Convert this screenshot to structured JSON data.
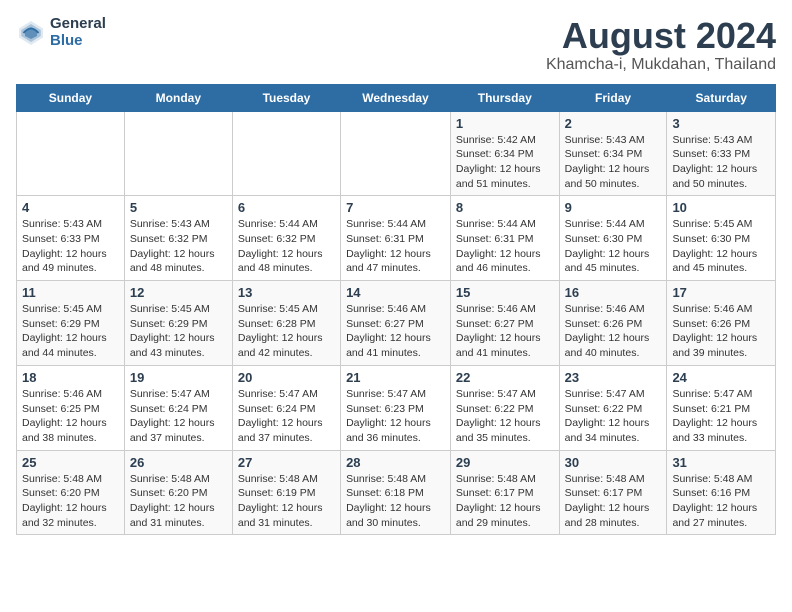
{
  "header": {
    "logo_general": "General",
    "logo_blue": "Blue",
    "title": "August 2024",
    "subtitle": "Khamcha-i, Mukdahan, Thailand"
  },
  "weekdays": [
    "Sunday",
    "Monday",
    "Tuesday",
    "Wednesday",
    "Thursday",
    "Friday",
    "Saturday"
  ],
  "weeks": [
    [
      {
        "day": "",
        "detail": ""
      },
      {
        "day": "",
        "detail": ""
      },
      {
        "day": "",
        "detail": ""
      },
      {
        "day": "",
        "detail": ""
      },
      {
        "day": "1",
        "detail": "Sunrise: 5:42 AM\nSunset: 6:34 PM\nDaylight: 12 hours\nand 51 minutes."
      },
      {
        "day": "2",
        "detail": "Sunrise: 5:43 AM\nSunset: 6:34 PM\nDaylight: 12 hours\nand 50 minutes."
      },
      {
        "day": "3",
        "detail": "Sunrise: 5:43 AM\nSunset: 6:33 PM\nDaylight: 12 hours\nand 50 minutes."
      }
    ],
    [
      {
        "day": "4",
        "detail": "Sunrise: 5:43 AM\nSunset: 6:33 PM\nDaylight: 12 hours\nand 49 minutes."
      },
      {
        "day": "5",
        "detail": "Sunrise: 5:43 AM\nSunset: 6:32 PM\nDaylight: 12 hours\nand 48 minutes."
      },
      {
        "day": "6",
        "detail": "Sunrise: 5:44 AM\nSunset: 6:32 PM\nDaylight: 12 hours\nand 48 minutes."
      },
      {
        "day": "7",
        "detail": "Sunrise: 5:44 AM\nSunset: 6:31 PM\nDaylight: 12 hours\nand 47 minutes."
      },
      {
        "day": "8",
        "detail": "Sunrise: 5:44 AM\nSunset: 6:31 PM\nDaylight: 12 hours\nand 46 minutes."
      },
      {
        "day": "9",
        "detail": "Sunrise: 5:44 AM\nSunset: 6:30 PM\nDaylight: 12 hours\nand 45 minutes."
      },
      {
        "day": "10",
        "detail": "Sunrise: 5:45 AM\nSunset: 6:30 PM\nDaylight: 12 hours\nand 45 minutes."
      }
    ],
    [
      {
        "day": "11",
        "detail": "Sunrise: 5:45 AM\nSunset: 6:29 PM\nDaylight: 12 hours\nand 44 minutes."
      },
      {
        "day": "12",
        "detail": "Sunrise: 5:45 AM\nSunset: 6:29 PM\nDaylight: 12 hours\nand 43 minutes."
      },
      {
        "day": "13",
        "detail": "Sunrise: 5:45 AM\nSunset: 6:28 PM\nDaylight: 12 hours\nand 42 minutes."
      },
      {
        "day": "14",
        "detail": "Sunrise: 5:46 AM\nSunset: 6:27 PM\nDaylight: 12 hours\nand 41 minutes."
      },
      {
        "day": "15",
        "detail": "Sunrise: 5:46 AM\nSunset: 6:27 PM\nDaylight: 12 hours\nand 41 minutes."
      },
      {
        "day": "16",
        "detail": "Sunrise: 5:46 AM\nSunset: 6:26 PM\nDaylight: 12 hours\nand 40 minutes."
      },
      {
        "day": "17",
        "detail": "Sunrise: 5:46 AM\nSunset: 6:26 PM\nDaylight: 12 hours\nand 39 minutes."
      }
    ],
    [
      {
        "day": "18",
        "detail": "Sunrise: 5:46 AM\nSunset: 6:25 PM\nDaylight: 12 hours\nand 38 minutes."
      },
      {
        "day": "19",
        "detail": "Sunrise: 5:47 AM\nSunset: 6:24 PM\nDaylight: 12 hours\nand 37 minutes."
      },
      {
        "day": "20",
        "detail": "Sunrise: 5:47 AM\nSunset: 6:24 PM\nDaylight: 12 hours\nand 37 minutes."
      },
      {
        "day": "21",
        "detail": "Sunrise: 5:47 AM\nSunset: 6:23 PM\nDaylight: 12 hours\nand 36 minutes."
      },
      {
        "day": "22",
        "detail": "Sunrise: 5:47 AM\nSunset: 6:22 PM\nDaylight: 12 hours\nand 35 minutes."
      },
      {
        "day": "23",
        "detail": "Sunrise: 5:47 AM\nSunset: 6:22 PM\nDaylight: 12 hours\nand 34 minutes."
      },
      {
        "day": "24",
        "detail": "Sunrise: 5:47 AM\nSunset: 6:21 PM\nDaylight: 12 hours\nand 33 minutes."
      }
    ],
    [
      {
        "day": "25",
        "detail": "Sunrise: 5:48 AM\nSunset: 6:20 PM\nDaylight: 12 hours\nand 32 minutes."
      },
      {
        "day": "26",
        "detail": "Sunrise: 5:48 AM\nSunset: 6:20 PM\nDaylight: 12 hours\nand 31 minutes."
      },
      {
        "day": "27",
        "detail": "Sunrise: 5:48 AM\nSunset: 6:19 PM\nDaylight: 12 hours\nand 31 minutes."
      },
      {
        "day": "28",
        "detail": "Sunrise: 5:48 AM\nSunset: 6:18 PM\nDaylight: 12 hours\nand 30 minutes."
      },
      {
        "day": "29",
        "detail": "Sunrise: 5:48 AM\nSunset: 6:17 PM\nDaylight: 12 hours\nand 29 minutes."
      },
      {
        "day": "30",
        "detail": "Sunrise: 5:48 AM\nSunset: 6:17 PM\nDaylight: 12 hours\nand 28 minutes."
      },
      {
        "day": "31",
        "detail": "Sunrise: 5:48 AM\nSunset: 6:16 PM\nDaylight: 12 hours\nand 27 minutes."
      }
    ]
  ]
}
